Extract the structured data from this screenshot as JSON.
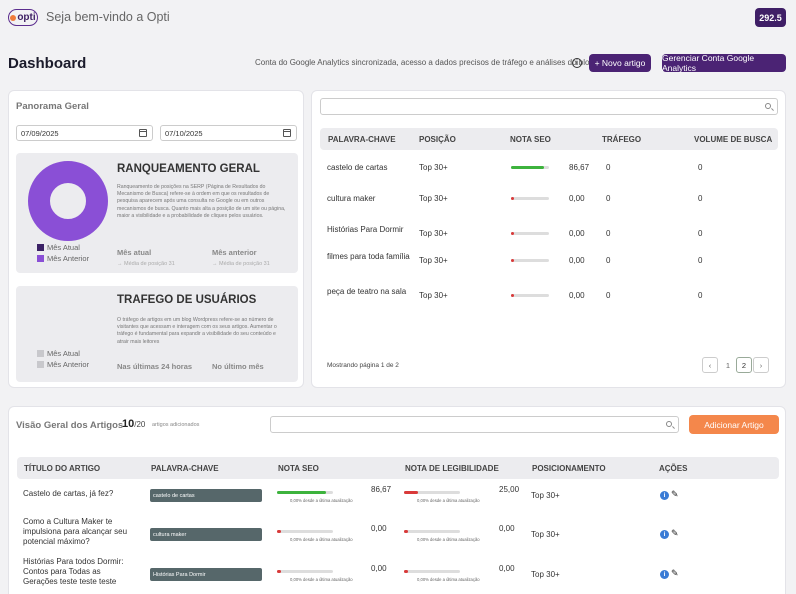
{
  "header": {
    "logo_text": "opti",
    "welcome": "Seja bem-vindo a Opti",
    "credits": "292.5"
  },
  "dashboard": {
    "title": "Dashboard",
    "sync_text": "Conta do Google Analytics sincronizada, acesso a dados precisos de tráfego e análises do blog",
    "new_article_label": "+ Novo artigo",
    "manage_ga_label": "Gerenciar Conta Google Analytics"
  },
  "panorama": {
    "title": "Panorama Geral",
    "date_start": "07/09/2025",
    "date_end": "07/10/2025",
    "ranking": {
      "title": "RANQUEAMENTO GERAL",
      "description": "Ranqueamento de posições na SERP (Página de Resultados do Mecanismo de Busca) refere-se à ordem em que os resultados de pesquisa aparecem após uma consulta no Google ou em outros mecanismos de busca. Quanto mais alta a posição de um site ou página, maior a visibilidade e a probabilidade de cliques pelos usuários.",
      "legend_current": "Mês Atual",
      "legend_previous": "Mês Anterior",
      "color_current": "#3b2166",
      "color_previous": "#8a4fd6",
      "current_label": "Mês atual",
      "current_sub": "→ Média de posição 31",
      "previous_label": "Mês anterior",
      "previous_sub": "→ Média de posição 31"
    },
    "traffic": {
      "title": "TRAFEGO DE USUÁRIOS",
      "description": "O tráfego de artigos em um blog Wordpress refere-se ao número de visitantes que acessam e interagem com os seus artigos. Aumentar o tráfego é fundamental para expandir a visibilidade do seu conteúdo e atrair mais leitores",
      "legend_current": "Mês Atual",
      "legend_previous": "Mês Anterior",
      "last_24h_label": "Nas últimas 24 horas",
      "last_month_label": "No último mês"
    }
  },
  "keywords": {
    "headers": [
      "PALAVRA-CHAVE",
      "POSIÇÃO",
      "NOTA SEO",
      "TRÁFEGO",
      "VOLUME DE BUSCA"
    ],
    "rows": [
      {
        "keyword": "castelo de cartas",
        "position": "Top 30+",
        "seo": "86,67",
        "seo_value": 86.67,
        "traffic": "0",
        "volume": "0"
      },
      {
        "keyword": "cultura maker",
        "position": "Top 30+",
        "seo": "0,00",
        "seo_value": 0,
        "traffic": "0",
        "volume": "0"
      },
      {
        "keyword": "Histórias Para Dormir",
        "position": "Top 30+",
        "seo": "0,00",
        "seo_value": 0,
        "traffic": "0",
        "volume": "0"
      },
      {
        "keyword": "filmes para toda família",
        "position": "Top 30+",
        "seo": "0,00",
        "seo_value": 0,
        "traffic": "0",
        "volume": "0"
      },
      {
        "keyword": "peça de teatro na sala",
        "position": "Top 30+",
        "seo": "0,00",
        "seo_value": 0,
        "traffic": "0",
        "volume": "0"
      }
    ],
    "pagination_text": "Mostrando página 1 de 2",
    "pages": [
      "1",
      "2"
    ],
    "current_page": "2",
    "prev_icon": "‹",
    "next_icon": "›"
  },
  "articles": {
    "title": "Visão Geral dos Artigos",
    "count": "10",
    "total": "/20",
    "count_label": "artigos adicionados",
    "add_label": "Adicionar Artigo",
    "headers": [
      "TÍTULO DO ARTIGO",
      "PALAVRA-CHAVE",
      "NOTA SEO",
      "NOTA DE LEGIBILIDADE",
      "POSICIONAMENTO",
      "AÇÕES"
    ],
    "update_note": "0,00% desde a última atualização",
    "rows": [
      {
        "title": "Castelo de cartas, já fez?",
        "keyword": "castelo de cartas",
        "seo": "86,67",
        "seo_value": 86.67,
        "readability": "25,00",
        "readability_value": 25,
        "position": "Top 30+"
      },
      {
        "title": "Como a Cultura Maker te impulsiona para alcançar seu potencial máximo?",
        "keyword": "cultura maker",
        "seo": "0,00",
        "seo_value": 0,
        "readability": "0,00",
        "readability_value": 0,
        "position": "Top 30+"
      },
      {
        "title": "Histórias Para todos Dormir: Contos para Todas as Gerações teste teste teste",
        "keyword": "Histórias Para Dormir",
        "seo": "0,00",
        "seo_value": 0,
        "readability": "0,00",
        "readability_value": 0,
        "position": "Top 30+"
      }
    ]
  },
  "colors": {
    "good": "#3db33d",
    "bad": "#d93a3a"
  }
}
